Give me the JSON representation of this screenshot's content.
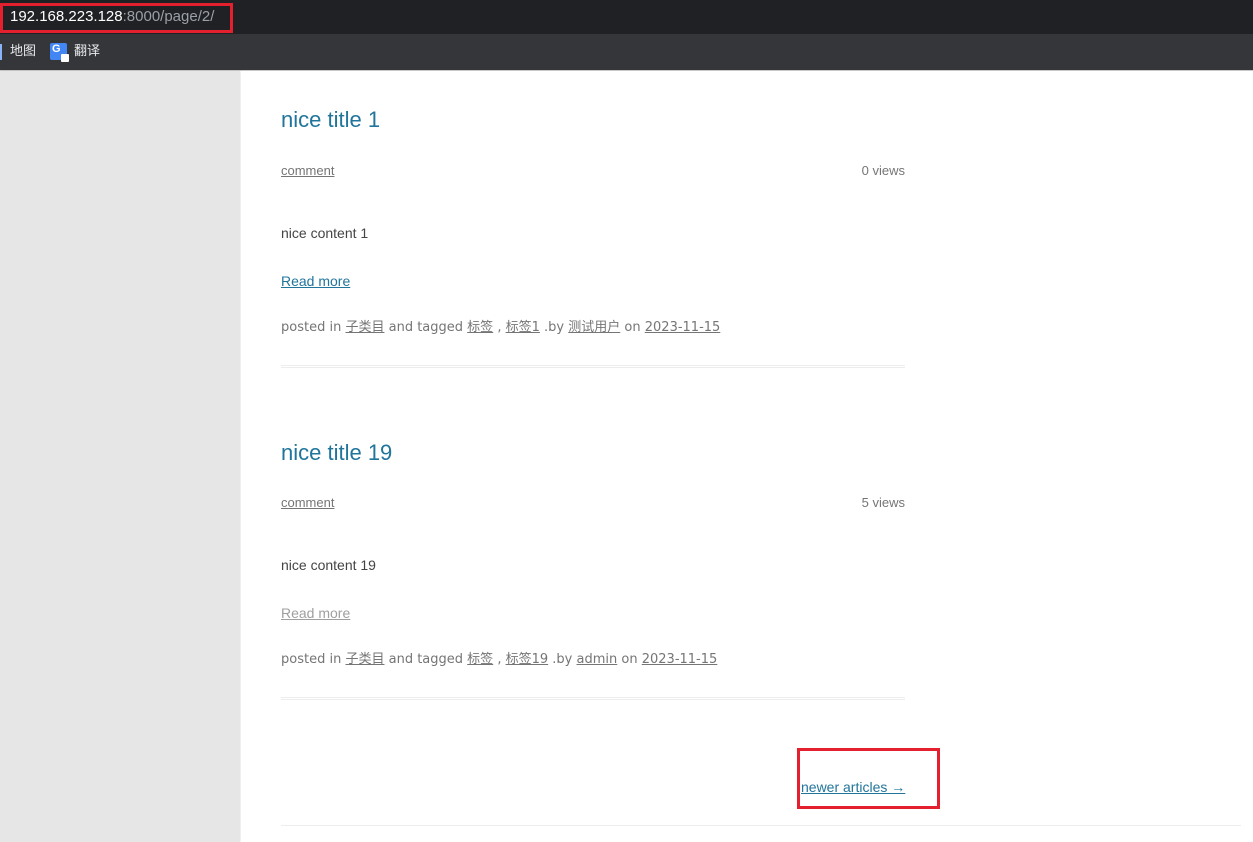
{
  "browser": {
    "url_host": "192.168.223.128",
    "url_path": ":8000/page/2/",
    "bookmarks": [
      {
        "label": "地图",
        "icon": "map-icon"
      },
      {
        "label": "翻译",
        "icon": "google-translate-icon"
      }
    ]
  },
  "articles": [
    {
      "title": "nice title 1",
      "comment_label": "comment",
      "views": "0 views",
      "content": "nice content 1",
      "read_more": "Read more",
      "footer": {
        "posted_in_text": "posted in",
        "category": "子类目",
        "tagged_text": "and tagged",
        "tag1": "标签",
        "comma": ",",
        "tag2": "标签1",
        "by_text": ".by",
        "author": "测试用户",
        "on_text": "on",
        "date": "2023-11-15"
      }
    },
    {
      "title": "nice title 19",
      "comment_label": "comment",
      "views": "5 views",
      "content": "nice content 19",
      "read_more": "Read more",
      "footer": {
        "posted_in_text": "posted in",
        "category": "子类目",
        "tagged_text": "and tagged",
        "tag1": "标签",
        "comma": ",",
        "tag2": "标签19",
        "by_text": ".by",
        "author": "admin",
        "on_text": "on",
        "date": "2023-11-15"
      }
    }
  ],
  "pagination": {
    "newer_label": "newer articles →"
  },
  "colors": {
    "highlight": "#e5202e",
    "link": "#21759b",
    "visited": "#9f9f9f"
  }
}
